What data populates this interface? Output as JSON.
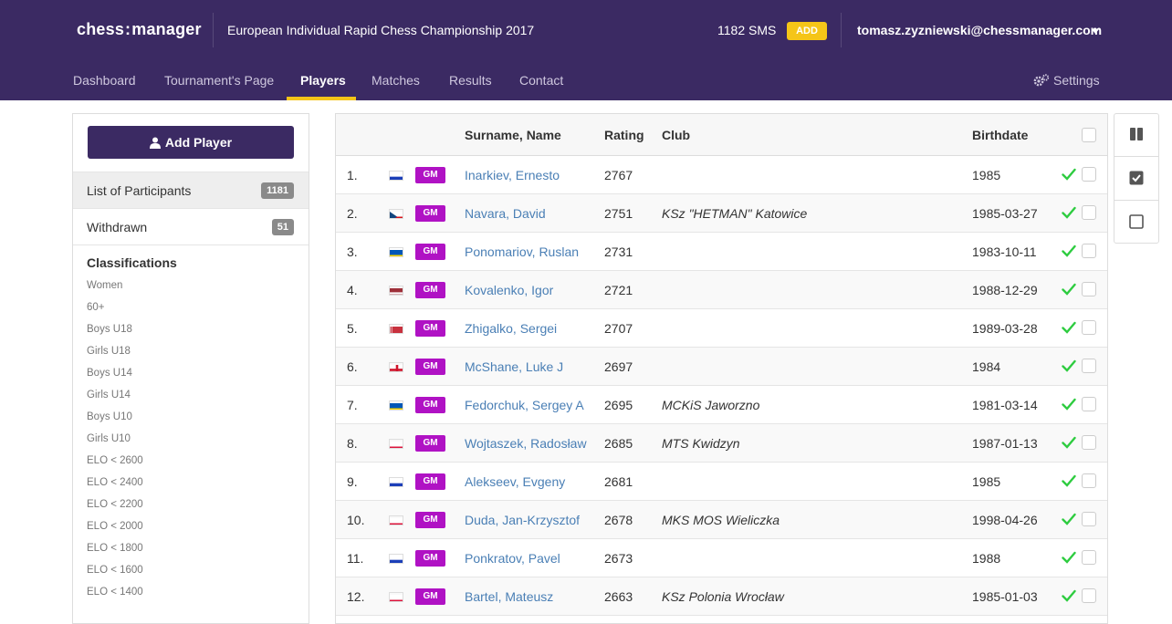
{
  "header": {
    "logo_left": "chess",
    "logo_colon": ":",
    "logo_right": "manager",
    "tournament_title": "European Individual Rapid Chess Championship 2017",
    "sms": "1182 SMS",
    "add_label": "ADD",
    "user_email": "tomasz.zyzniewski@chessmanager.com"
  },
  "nav": {
    "items": [
      "Dashboard",
      "Tournament's Page",
      "Players",
      "Matches",
      "Results",
      "Contact"
    ],
    "active": "Players",
    "settings": "Settings"
  },
  "sidebar": {
    "add_player": "Add Player",
    "list_label": "List of Participants",
    "list_count": "1181",
    "withdrawn_label": "Withdrawn",
    "withdrawn_count": "51",
    "classifications_title": "Classifications",
    "classifications": [
      "Women",
      "60+",
      "Boys U18",
      "Girls U18",
      "Boys U14",
      "Girls U14",
      "Boys U10",
      "Girls U10",
      "ELO < 2600",
      "ELO < 2400",
      "ELO < 2200",
      "ELO < 2000",
      "ELO < 1800",
      "ELO < 1600",
      "ELO < 1400"
    ]
  },
  "table": {
    "headers": {
      "name": "Surname, Name",
      "rating": "Rating",
      "club": "Club",
      "birthdate": "Birthdate"
    },
    "rows": [
      {
        "no": "1.",
        "flag": "ru",
        "title": "GM",
        "name": "Inarkiev, Ernesto",
        "rating": "2767",
        "club": "",
        "birthdate": "1985"
      },
      {
        "no": "2.",
        "flag": "cz",
        "title": "GM",
        "name": "Navara, David",
        "rating": "2751",
        "club": "KSz \"HETMAN\" Katowice",
        "birthdate": "1985-03-27"
      },
      {
        "no": "3.",
        "flag": "ua",
        "title": "GM",
        "name": "Ponomariov, Ruslan",
        "rating": "2731",
        "club": "",
        "birthdate": "1983-10-11"
      },
      {
        "no": "4.",
        "flag": "lv",
        "title": "GM",
        "name": "Kovalenko, Igor",
        "rating": "2721",
        "club": "",
        "birthdate": "1988-12-29"
      },
      {
        "no": "5.",
        "flag": "by",
        "title": "GM",
        "name": "Zhigalko, Sergei",
        "rating": "2707",
        "club": "",
        "birthdate": "1989-03-28"
      },
      {
        "no": "6.",
        "flag": "en",
        "title": "GM",
        "name": "McShane, Luke J",
        "rating": "2697",
        "club": "",
        "birthdate": "1984"
      },
      {
        "no": "7.",
        "flag": "ua",
        "title": "GM",
        "name": "Fedorchuk, Sergey A",
        "rating": "2695",
        "club": "MCKiS Jaworzno",
        "birthdate": "1981-03-14"
      },
      {
        "no": "8.",
        "flag": "pl",
        "title": "GM",
        "name": "Wojtaszek, Radosław",
        "rating": "2685",
        "club": "MTS Kwidzyn",
        "birthdate": "1987-01-13"
      },
      {
        "no": "9.",
        "flag": "ru",
        "title": "GM",
        "name": "Alekseev, Evgeny",
        "rating": "2681",
        "club": "",
        "birthdate": "1985"
      },
      {
        "no": "10.",
        "flag": "pl",
        "title": "GM",
        "name": "Duda, Jan-Krzysztof",
        "rating": "2678",
        "club": "MKS MOS Wieliczka",
        "birthdate": "1998-04-26"
      },
      {
        "no": "11.",
        "flag": "ru",
        "title": "GM",
        "name": "Ponkratov, Pavel",
        "rating": "2673",
        "club": "",
        "birthdate": "1988"
      },
      {
        "no": "12.",
        "flag": "pl",
        "title": "GM",
        "name": "Bartel, Mateusz",
        "rating": "2663",
        "club": "KSz Polonia Wrocław",
        "birthdate": "1985-01-03"
      }
    ]
  },
  "tools": [
    "columns-icon",
    "check-all-icon",
    "uncheck-all-icon"
  ],
  "colors": {
    "header_bg": "#3b2a63",
    "accent": "#f5c518",
    "gm_badge": "#b012c4",
    "link": "#4a7fb5",
    "tick": "#2ecc40"
  }
}
